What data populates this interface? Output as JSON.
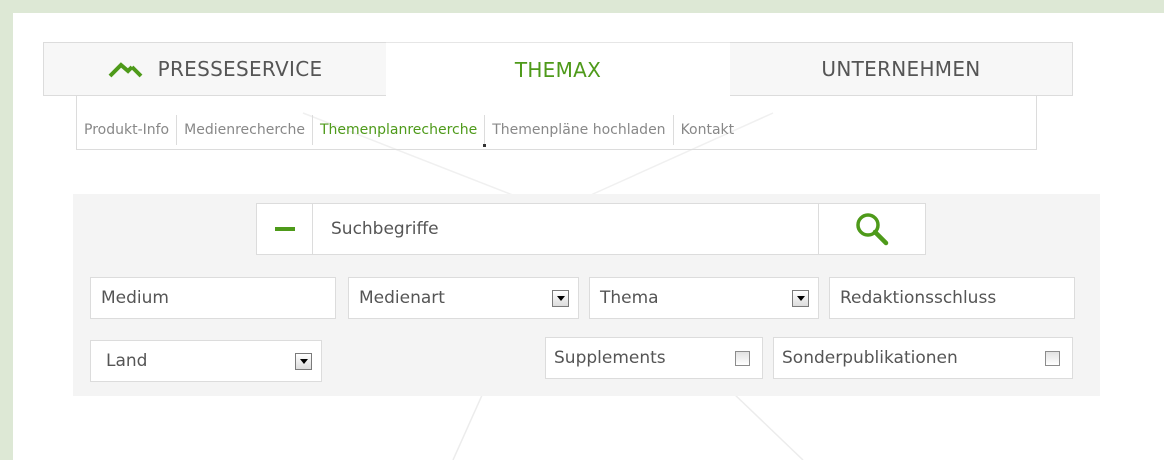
{
  "colors": {
    "accent": "#4e9a1a",
    "page_background": "#dde8d5",
    "text": "#555555"
  },
  "tabs": [
    {
      "label": "PRESSESERVICE",
      "icon": "home-roof-icon",
      "active": false
    },
    {
      "label": "THEMAX",
      "active": true
    },
    {
      "label": "UNTERNEHMEN",
      "active": false
    }
  ],
  "subnav": [
    {
      "label": "Produkt-Info",
      "active": false
    },
    {
      "label": "Medienrecherche",
      "active": false
    },
    {
      "label": "Themenplanrecherche",
      "active": true
    },
    {
      "label": "Themenpläne hochladen",
      "active": false
    },
    {
      "label": "Kontakt",
      "active": false
    }
  ],
  "search": {
    "toggle_icon": "minus-icon",
    "placeholder": "Suchbegriffe",
    "button_icon": "search-icon"
  },
  "filters": {
    "medium_placeholder": "Medium",
    "medienart_label": "Medienart",
    "thema_label": "Thema",
    "redaktionsschluss_placeholder": "Redaktionsschluss",
    "land_label": "Land",
    "supplements_label": "Supplements",
    "supplements_checked": false,
    "sonderpublikationen_label": "Sonderpublikationen",
    "sonderpublikationen_checked": false
  }
}
